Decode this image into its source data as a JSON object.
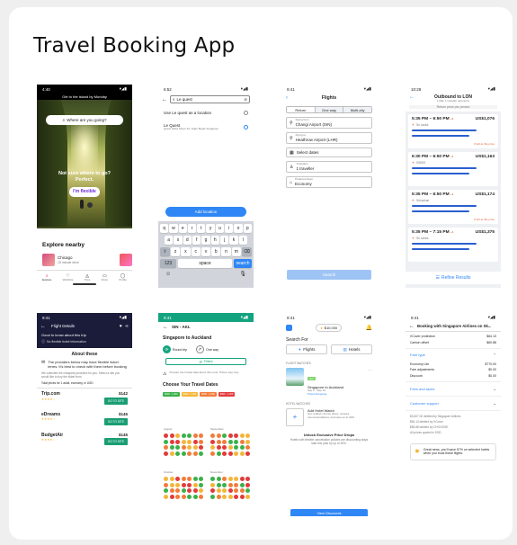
{
  "page_title": "Travel Booking App",
  "s1": {
    "time": "4:40",
    "banner": "Get to the island by Monday",
    "search_placeholder": "Where are you going?",
    "hero_line1": "Not sure where to go?",
    "hero_line2": "Perfect.",
    "cta": "I'm flexible",
    "explore_title": "Explore nearby",
    "nearby": [
      {
        "name": "Chicago",
        "sub": "15 minute drive"
      }
    ],
    "tabs": [
      "Explore",
      "Wishlists",
      "Trips",
      "Inbox",
      "Profile"
    ]
  },
  "s2": {
    "time": "6:52",
    "query": "Le quest",
    "use_location": "Use Le quest as a location",
    "result_name": "Le Quest",
    "result_addr": "Quest Haha Street 10, Jalan Besar Singapore",
    "button": "Add location",
    "keys_row1": [
      "q",
      "w",
      "e",
      "r",
      "t",
      "y",
      "u",
      "i",
      "o",
      "p"
    ],
    "keys_row2": [
      "a",
      "s",
      "d",
      "f",
      "g",
      "h",
      "j",
      "k",
      "l"
    ],
    "keys_row3": [
      "z",
      "x",
      "c",
      "v",
      "b",
      "n",
      "m"
    ],
    "key_num": "123",
    "key_space": "space",
    "key_search": "search"
  },
  "s3": {
    "time": "9:41",
    "title": "Flights",
    "trip_types": [
      "Return",
      "One way",
      "Multi-city"
    ],
    "from_label": "Flying from",
    "from_value": "Changi Airport (SIN)",
    "to_label": "Flying to",
    "to_value": "Heathrow Airport (LHR)",
    "dates": "Select dates",
    "travellers_label": "Travellers",
    "travellers_value": "1 traveller",
    "class_label": "Preferred Seat",
    "class_value": "Economy",
    "search_btn": "Search"
  },
  "s4": {
    "time": "10:28",
    "title": "Outbound to LON",
    "subtitle": "1 Mar, 1 traveller, Economy",
    "note": "Return price per person",
    "flights": [
      {
        "dep": "5:35 PM",
        "arr": "6:50 PM",
        "plus": "+1",
        "price": "US$1,076",
        "airline": "Sri Lanka",
        "left": "8 left at this price"
      },
      {
        "dep": "6:30 PM",
        "arr": "6:50 PM",
        "plus": "+1",
        "price": "US$1,163",
        "airline": "SWISS",
        "left": ""
      },
      {
        "dep": "5:35 PM",
        "arr": "6:50 PM",
        "plus": "+1",
        "price": "US$1,174",
        "airline": "SriLankan",
        "left": "8 left at this price"
      },
      {
        "dep": "5:35 PM",
        "arr": "7:15 PM",
        "plus": "+1",
        "price": "US$1,375",
        "airline": "Sri Lanka",
        "left": ""
      }
    ],
    "refine": "Refine Results"
  },
  "s5": {
    "time": "9:41",
    "title": "Flight Details",
    "banner_title": "Good to know about this trip",
    "banner_sub": "No flexible ticket information",
    "about": "About these",
    "provider_note": "The providers below may have flexible ticket terms. It's best to check with them before booking",
    "refreshed": "We collected the cheapest providers for you. Select a site you would like to buy the ticket from",
    "total": "Total prices for 1 adult, economy, in USD",
    "providers": [
      {
        "name": "Trip.com",
        "price": "$142",
        "cta": "GO TO SITE"
      },
      {
        "name": "eDreams",
        "price": "$145",
        "cta": "GO TO SITE"
      },
      {
        "name": "BudgetAir",
        "price": "$145",
        "cta": "GO TO SITE"
      }
    ]
  },
  "s6": {
    "time": "9:41",
    "route": "SIN - AKL",
    "title": "Singapore to Auckland",
    "round": "Round trip",
    "oneway": "One way",
    "filters": "Filters",
    "notice": "Prepare two limited data about this route. Prices may vary.",
    "cal_title": "Choose Your Travel Dates",
    "price_ranges": [
      "$000 - 1,000",
      "$000 - 1,000",
      "$000 - 1,000",
      "$000 - 1,000"
    ],
    "months": [
      "August",
      "September",
      "October",
      "November"
    ]
  },
  "s7": {
    "time": "9:41",
    "balance": "$10,000",
    "search_for": "Search For",
    "flights": "Flights",
    "hotels": "Hotels",
    "flight_watches": "FLIGHT WATCHES",
    "watch_tag": "Hot",
    "watch_title": "Singapore to Auckland",
    "watch_dates": "Sep 1 - Sep 10",
    "watch_link": "Prices Dropping",
    "hotel_watches": "HOTEL WATCHES",
    "add_hotel": "Add Hotel Watch",
    "add_hotel_sub": "Get notified of price drops, reviews, recommendations, and save up to 30%",
    "unlock": "Unlock Exclusive Price Drops",
    "unlock_sub": "Hotels with flexible cancellation policies are discounting stays later this year by up to 30%.",
    "view": "View Discounts"
  },
  "s8": {
    "time": "9:41",
    "title": "Booking with Singapore Airlines on Sk...",
    "lines": [
      {
        "label": "XCover protection",
        "value": "$64.13"
      },
      {
        "label": "Carbon offset",
        "value": "$60.88"
      }
    ],
    "fare_type": "Fare type",
    "fare_lines": [
      {
        "label": "Economy Lite",
        "value": "$770.00"
      },
      {
        "label": "Fare adjustments",
        "value": "$0.00"
      },
      {
        "label": "Discount",
        "value": "$0.00"
      }
    ],
    "fees": "Fees and taxes",
    "support": "Customer support",
    "totals": [
      "$2,607.00 debited by Singapore Airlines",
      "$54.13 debited by XCover",
      "$55.88 debited by CHOOOSE",
      "All prices quoted in SGD"
    ],
    "promo": "Great news, you'll save 57% on selected hotels when you book these flights."
  }
}
